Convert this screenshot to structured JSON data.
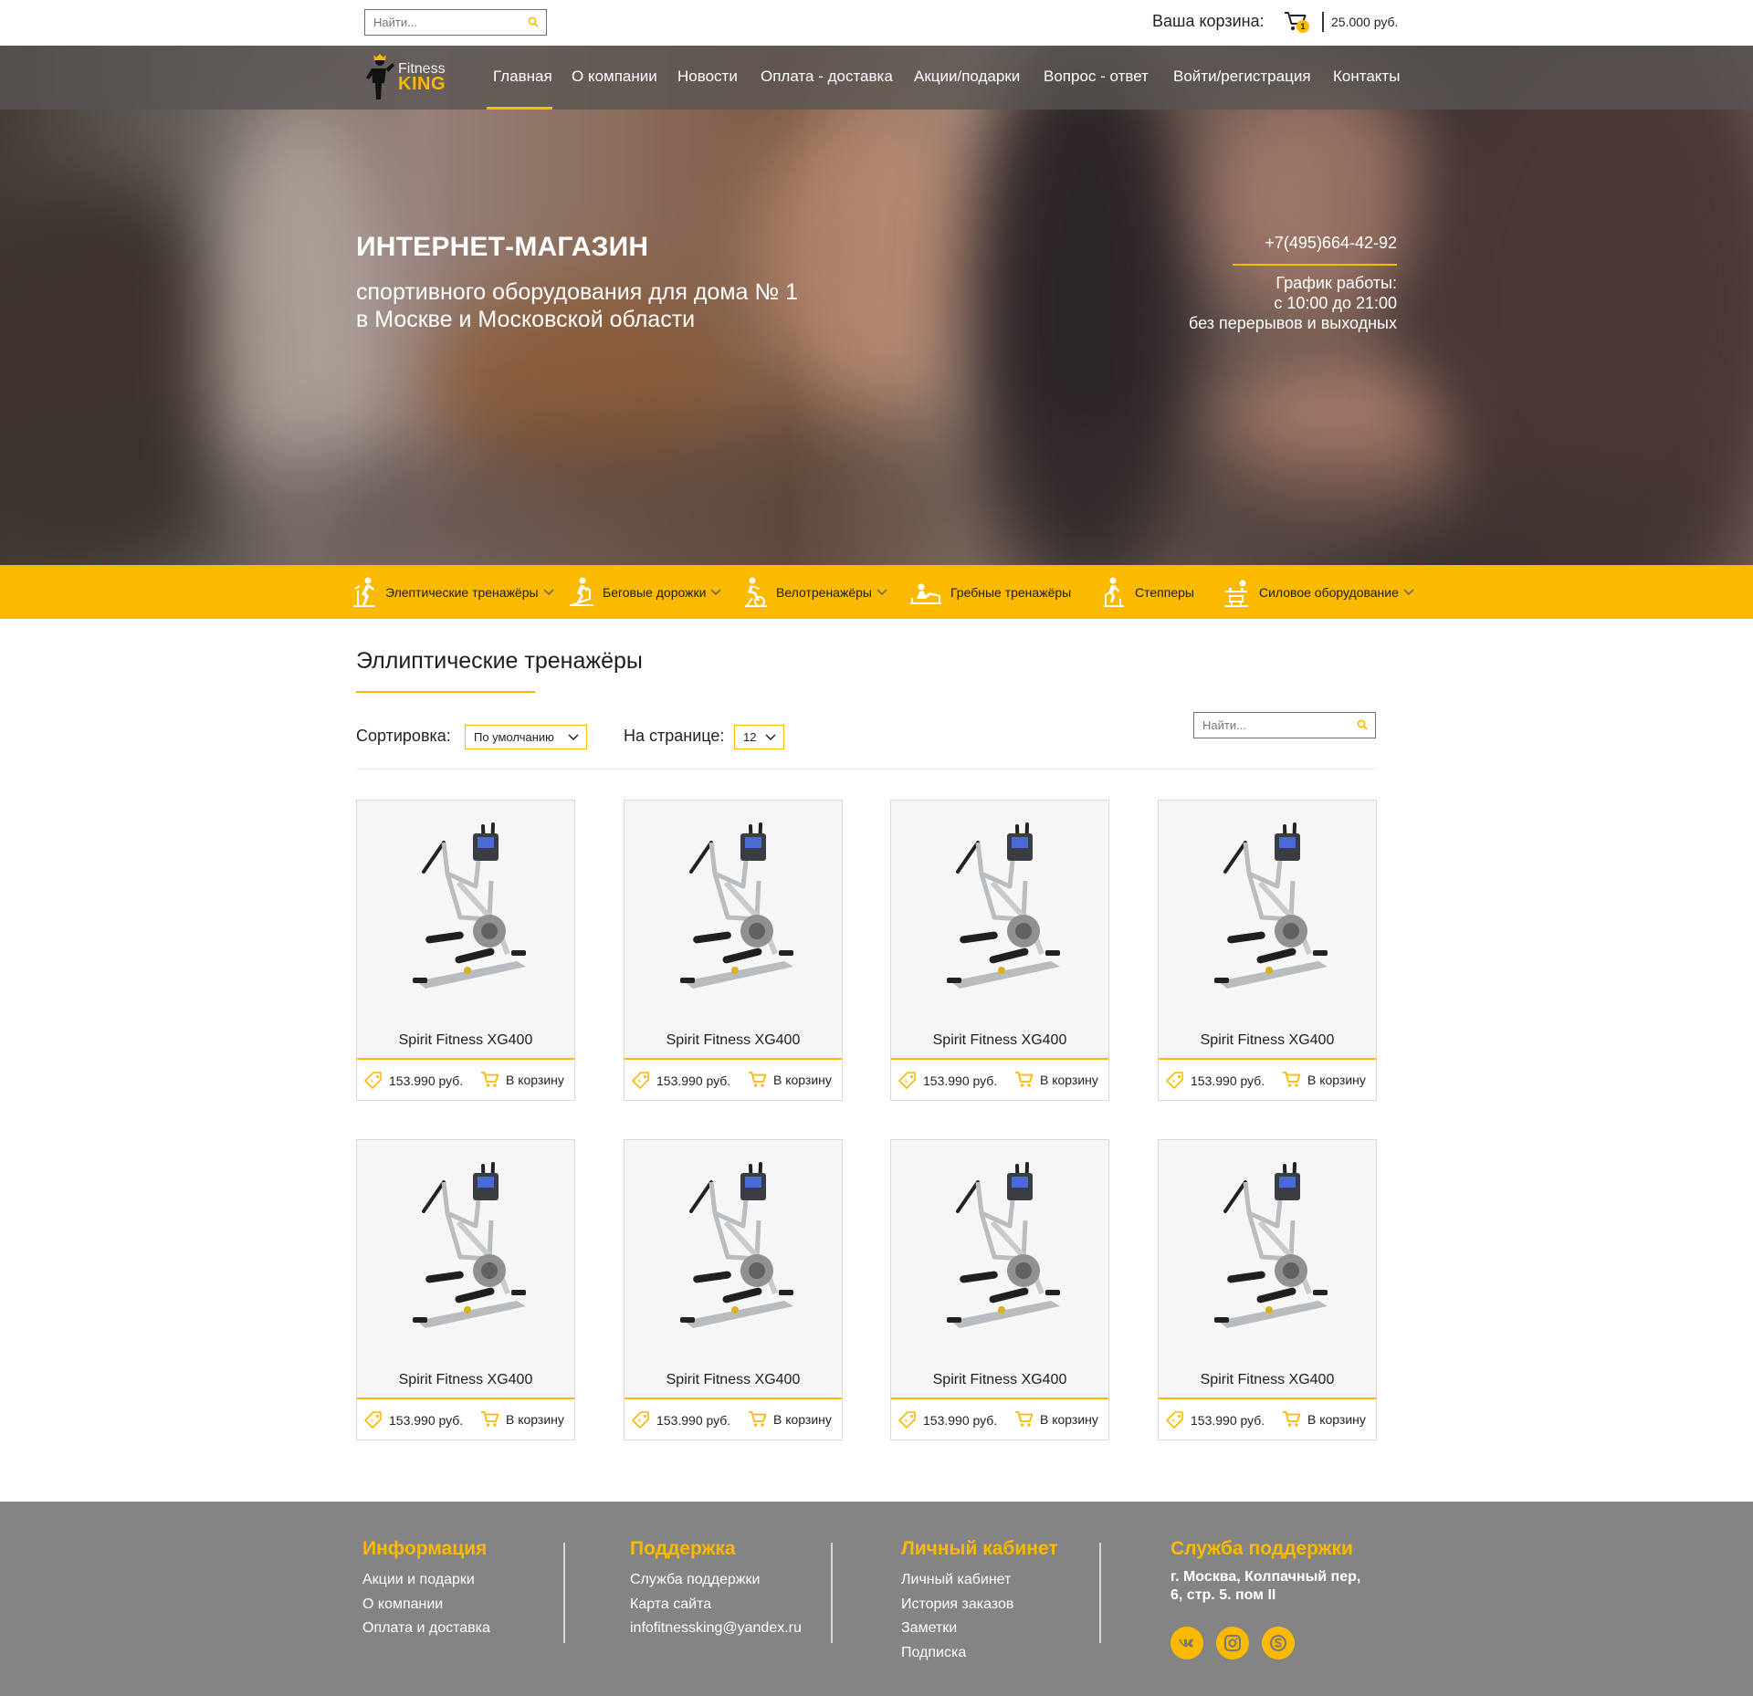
{
  "topbar": {
    "search_placeholder": "Найти...",
    "cart_label": "Ваша корзина:",
    "cart_count": "1",
    "cart_total": "25.000 руб."
  },
  "logo": {
    "line1": "Fitness",
    "line2": "KING"
  },
  "nav": {
    "items": [
      "Главная",
      "О компании",
      "Новости",
      "Оплата - доставка",
      "Акции/подарки",
      "Вопрос - ответ",
      "Войти/регистрация",
      "Контакты"
    ],
    "active_index": 0
  },
  "hero": {
    "title": "ИНТЕРНЕТ-МАГАЗИН",
    "subtitle_line1": "спортивного оборудования для дома № 1",
    "subtitle_line2": "в Москве и Московской области",
    "phone": "+7(495)664-42-92",
    "hours_line1": "График работы:",
    "hours_line2": "с 10:00 до 21:00",
    "hours_line3": "без перерывов и выходных"
  },
  "categories": [
    {
      "label": "Элептические тренажёры",
      "icon": "elliptical-icon",
      "dropdown": true
    },
    {
      "label": "Беговые дорожки",
      "icon": "treadmill-icon",
      "dropdown": true
    },
    {
      "label": "Велотренажёры",
      "icon": "bike-icon",
      "dropdown": true
    },
    {
      "label": "Гребные тренажёры",
      "icon": "rowing-icon",
      "dropdown": false
    },
    {
      "label": "Степперы",
      "icon": "stepper-icon",
      "dropdown": false
    },
    {
      "label": "Силовое оборудование",
      "icon": "weights-icon",
      "dropdown": true
    }
  ],
  "listing": {
    "title": "Эллиптические тренажёры",
    "sort_label": "Сортировка:",
    "sort_value": "По умолчанию",
    "per_page_label": "На странице:",
    "per_page_value": "12",
    "search_placeholder": "Найти..."
  },
  "products": [
    {
      "name": "Spirit Fitness XG400",
      "price": "153.990 руб.",
      "buy_label": "В корзину"
    },
    {
      "name": "Spirit Fitness XG400",
      "price": "153.990 руб.",
      "buy_label": "В корзину"
    },
    {
      "name": "Spirit Fitness XG400",
      "price": "153.990 руб.",
      "buy_label": "В корзину"
    },
    {
      "name": "Spirit Fitness XG400",
      "price": "153.990 руб.",
      "buy_label": "В корзину"
    },
    {
      "name": "Spirit Fitness XG400",
      "price": "153.990 руб.",
      "buy_label": "В корзину"
    },
    {
      "name": "Spirit Fitness XG400",
      "price": "153.990 руб.",
      "buy_label": "В корзину"
    },
    {
      "name": "Spirit Fitness XG400",
      "price": "153.990 руб.",
      "buy_label": "В корзину"
    },
    {
      "name": "Spirit Fitness XG400",
      "price": "153.990 руб.",
      "buy_label": "В корзину"
    }
  ],
  "footer": {
    "info": {
      "title": "Информация",
      "links": [
        "Акции и подарки",
        "О компании",
        "Оплата и доставка"
      ]
    },
    "support": {
      "title": "Поддержка",
      "links": [
        "Служба поддержки",
        "Карта сайта",
        "infofitnessking@yandex.ru"
      ]
    },
    "account": {
      "title": "Личный кабинет",
      "links": [
        "Личный кабинет",
        "История заказов",
        "Заметки",
        "Подписка"
      ]
    },
    "service": {
      "title": "Служба поддержки",
      "address_line1": "г. Москва, Колпачный пер,",
      "address_line2": "6, стр. 5. пом II"
    },
    "social": [
      "vk-icon",
      "instagram-icon",
      "skype-icon"
    ]
  },
  "colors": {
    "accent": "#fbb900",
    "footer_bg": "#848484",
    "nav_bg": "#585452"
  }
}
